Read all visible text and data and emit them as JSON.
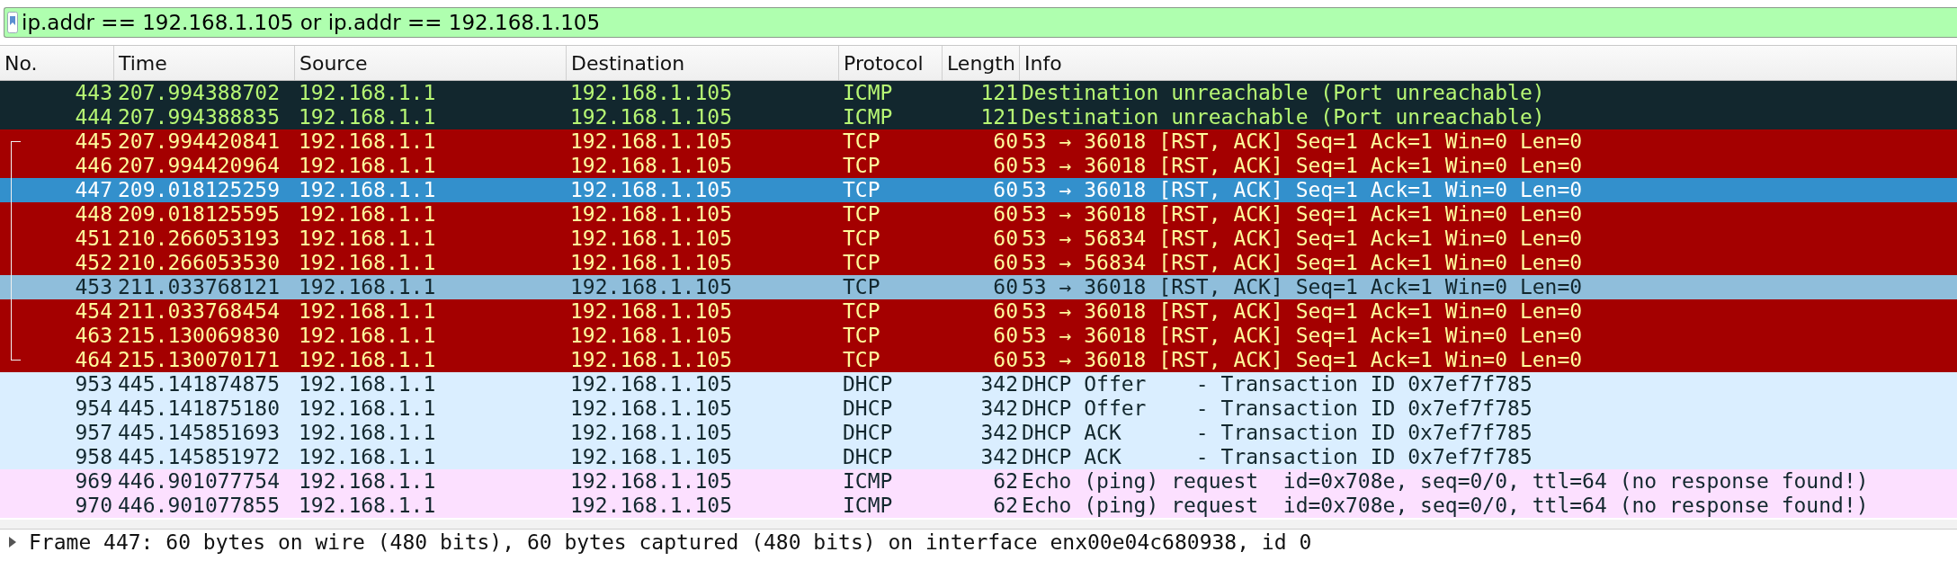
{
  "filter": {
    "value": "ip.addr == 192.168.1.105 or ip.addr == 192.168.1.105"
  },
  "columns": [
    "No.",
    "Time",
    "Source",
    "Destination",
    "Protocol",
    "Length",
    "Info"
  ],
  "rows": [
    {
      "no": "443",
      "time": "207.994388702",
      "source": "192.168.1.1",
      "destination": "192.168.1.105",
      "protocol": "ICMP",
      "length": "121",
      "info": "Destination unreachable (Port unreachable)",
      "kind": "icmp-error",
      "selected": false,
      "highlighted": false,
      "related": false
    },
    {
      "no": "444",
      "time": "207.994388835",
      "source": "192.168.1.1",
      "destination": "192.168.1.105",
      "protocol": "ICMP",
      "length": "121",
      "info": "Destination unreachable (Port unreachable)",
      "kind": "icmp-error",
      "selected": false,
      "highlighted": false,
      "related": false
    },
    {
      "no": "445",
      "time": "207.994420841",
      "source": "192.168.1.1",
      "destination": "192.168.1.105",
      "protocol": "TCP",
      "length": "60",
      "info": "53 → 36018 [RST, ACK] Seq=1 Ack=1 Win=0 Len=0",
      "kind": "tcp-reset",
      "selected": false,
      "highlighted": false,
      "related": true
    },
    {
      "no": "446",
      "time": "207.994420964",
      "source": "192.168.1.1",
      "destination": "192.168.1.105",
      "protocol": "TCP",
      "length": "60",
      "info": "53 → 36018 [RST, ACK] Seq=1 Ack=1 Win=0 Len=0",
      "kind": "tcp-reset",
      "selected": false,
      "highlighted": false,
      "related": true
    },
    {
      "no": "447",
      "time": "209.018125259",
      "source": "192.168.1.1",
      "destination": "192.168.1.105",
      "protocol": "TCP",
      "length": "60",
      "info": "53 → 36018 [RST, ACK] Seq=1 Ack=1 Win=0 Len=0",
      "kind": "tcp-reset",
      "selected": true,
      "highlighted": false,
      "related": true
    },
    {
      "no": "448",
      "time": "209.018125595",
      "source": "192.168.1.1",
      "destination": "192.168.1.105",
      "protocol": "TCP",
      "length": "60",
      "info": "53 → 36018 [RST, ACK] Seq=1 Ack=1 Win=0 Len=0",
      "kind": "tcp-reset",
      "selected": false,
      "highlighted": false,
      "related": true
    },
    {
      "no": "451",
      "time": "210.266053193",
      "source": "192.168.1.1",
      "destination": "192.168.1.105",
      "protocol": "TCP",
      "length": "60",
      "info": "53 → 56834 [RST, ACK] Seq=1 Ack=1 Win=0 Len=0",
      "kind": "tcp-reset",
      "selected": false,
      "highlighted": false,
      "related": true
    },
    {
      "no": "452",
      "time": "210.266053530",
      "source": "192.168.1.1",
      "destination": "192.168.1.105",
      "protocol": "TCP",
      "length": "60",
      "info": "53 → 56834 [RST, ACK] Seq=1 Ack=1 Win=0 Len=0",
      "kind": "tcp-reset",
      "selected": false,
      "highlighted": false,
      "related": true
    },
    {
      "no": "453",
      "time": "211.033768121",
      "source": "192.168.1.1",
      "destination": "192.168.1.105",
      "protocol": "TCP",
      "length": "60",
      "info": "53 → 36018 [RST, ACK] Seq=1 Ack=1 Win=0 Len=0",
      "kind": "tcp-reset",
      "selected": false,
      "highlighted": true,
      "related": true
    },
    {
      "no": "454",
      "time": "211.033768454",
      "source": "192.168.1.1",
      "destination": "192.168.1.105",
      "protocol": "TCP",
      "length": "60",
      "info": "53 → 36018 [RST, ACK] Seq=1 Ack=1 Win=0 Len=0",
      "kind": "tcp-reset",
      "selected": false,
      "highlighted": false,
      "related": true
    },
    {
      "no": "463",
      "time": "215.130069830",
      "source": "192.168.1.1",
      "destination": "192.168.1.105",
      "protocol": "TCP",
      "length": "60",
      "info": "53 → 36018 [RST, ACK] Seq=1 Ack=1 Win=0 Len=0",
      "kind": "tcp-reset",
      "selected": false,
      "highlighted": false,
      "related": true
    },
    {
      "no": "464",
      "time": "215.130070171",
      "source": "192.168.1.1",
      "destination": "192.168.1.105",
      "protocol": "TCP",
      "length": "60",
      "info": "53 → 36018 [RST, ACK] Seq=1 Ack=1 Win=0 Len=0",
      "kind": "tcp-reset",
      "selected": false,
      "highlighted": false,
      "related": true
    },
    {
      "no": "953",
      "time": "445.141874875",
      "source": "192.168.1.1",
      "destination": "192.168.1.105",
      "protocol": "DHCP",
      "length": "342",
      "info": "DHCP Offer    - Transaction ID 0x7ef7f785",
      "kind": "dhcp",
      "selected": false,
      "highlighted": false,
      "related": false
    },
    {
      "no": "954",
      "time": "445.141875180",
      "source": "192.168.1.1",
      "destination": "192.168.1.105",
      "protocol": "DHCP",
      "length": "342",
      "info": "DHCP Offer    - Transaction ID 0x7ef7f785",
      "kind": "dhcp",
      "selected": false,
      "highlighted": false,
      "related": false
    },
    {
      "no": "957",
      "time": "445.145851693",
      "source": "192.168.1.1",
      "destination": "192.168.1.105",
      "protocol": "DHCP",
      "length": "342",
      "info": "DHCP ACK      - Transaction ID 0x7ef7f785",
      "kind": "dhcp",
      "selected": false,
      "highlighted": false,
      "related": false
    },
    {
      "no": "958",
      "time": "445.145851972",
      "source": "192.168.1.1",
      "destination": "192.168.1.105",
      "protocol": "DHCP",
      "length": "342",
      "info": "DHCP ACK      - Transaction ID 0x7ef7f785",
      "kind": "dhcp",
      "selected": false,
      "highlighted": false,
      "related": false
    },
    {
      "no": "969",
      "time": "446.901077754",
      "source": "192.168.1.1",
      "destination": "192.168.1.105",
      "protocol": "ICMP",
      "length": "62",
      "info": "Echo (ping) request  id=0x708e, seq=0/0, ttl=64 (no response found!)",
      "kind": "icmp",
      "selected": false,
      "highlighted": false,
      "related": false
    },
    {
      "no": "970",
      "time": "446.901077855",
      "source": "192.168.1.1",
      "destination": "192.168.1.105",
      "protocol": "ICMP",
      "length": "62",
      "info": "Echo (ping) request  id=0x708e, seq=0/0, ttl=64 (no response found!)",
      "kind": "icmp",
      "selected": false,
      "highlighted": false,
      "related": false
    }
  ],
  "details": {
    "text": "Frame 447: 60 bytes on wire (480 bits), 60 bytes captured (480 bits) on interface enx00e04c680938, id 0",
    "expanded": false
  }
}
